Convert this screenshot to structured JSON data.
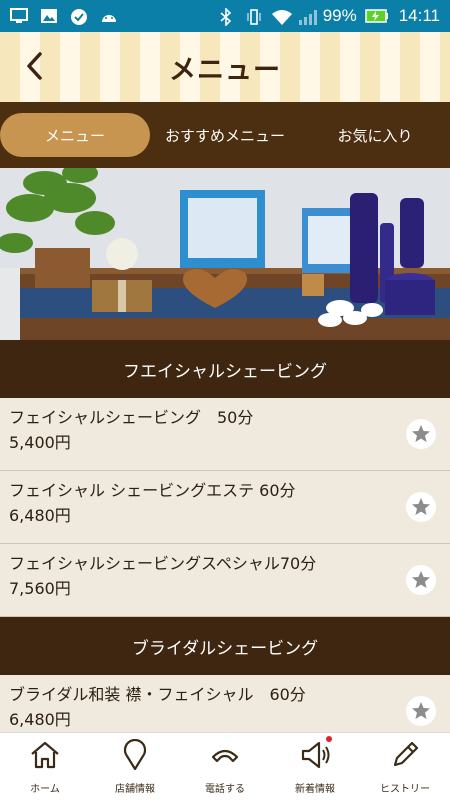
{
  "status_bar": {
    "battery": "99%",
    "time": "14:11"
  },
  "header": {
    "title": "メニュー"
  },
  "tabs": [
    {
      "label": "メニュー",
      "active": true
    },
    {
      "label": "おすすめメニュー",
      "active": false
    },
    {
      "label": "お気に入り",
      "active": false
    }
  ],
  "sections": [
    {
      "title": "フエイシャルシェービング",
      "items": [
        {
          "name": "フェイシャルシェービング　50分",
          "price": "5,400円"
        },
        {
          "name": "フェイシャル シェービングエステ 60分",
          "price": "6,480円"
        },
        {
          "name": "フェイシャルシェービングスペシャル70分",
          "price": "7,560円"
        }
      ]
    },
    {
      "title": "ブライダルシェービング",
      "items": [
        {
          "name": "ブライダル和装 襟・フェイシャル　60分",
          "price": "6,480円"
        }
      ]
    }
  ],
  "bottom_nav": [
    {
      "label": "ホーム",
      "icon": "home-icon"
    },
    {
      "label": "店舗情報",
      "icon": "map-pin-icon"
    },
    {
      "label": "電話する",
      "icon": "phone-icon"
    },
    {
      "label": "新着情報",
      "icon": "megaphone-icon"
    },
    {
      "label": "ヒストリー",
      "icon": "pencil-icon"
    }
  ],
  "colors": {
    "status_bar": "#0c7fa9",
    "tab_bar": "#4c2e10",
    "tab_active": "#c79550",
    "section_head": "#3f2611",
    "notification_dot": "#e0242a"
  }
}
